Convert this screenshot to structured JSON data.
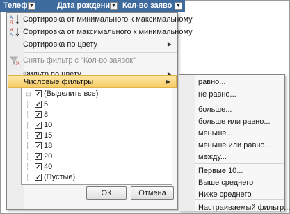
{
  "header": {
    "columns": [
      {
        "label": "Телефо",
        "has_dropdown": true
      },
      {
        "label": "Дата рождени",
        "has_dropdown": true
      },
      {
        "label": "Кол-во заявок",
        "has_dropdown": true,
        "active": true
      }
    ]
  },
  "menu": {
    "sort_asc": "Сортировка от минимального к максимальному",
    "sort_desc": "Сортировка от максимального к минимальному",
    "sort_by_color": "Сортировка по цвету",
    "clear_filter": "Снять фильтр с \"Кол-во заявок\"",
    "filter_by_color": "Фильтр по цвету",
    "number_filters": "Числовые фильтры",
    "icons": {
      "sort_asc": "sort-ascending-icon",
      "sort_desc": "sort-descending-icon",
      "clear": "clear-filter-icon"
    }
  },
  "checklist": {
    "items": [
      {
        "label": "(Выделить все)",
        "checked": true
      },
      {
        "label": "5",
        "checked": true
      },
      {
        "label": "8",
        "checked": true
      },
      {
        "label": "10",
        "checked": true
      },
      {
        "label": "15",
        "checked": true
      },
      {
        "label": "18",
        "checked": true
      },
      {
        "label": "20",
        "checked": true
      },
      {
        "label": "40",
        "checked": true
      },
      {
        "label": "(Пустые)",
        "checked": true
      }
    ],
    "check_mark": "✓"
  },
  "buttons": {
    "ok": "ОК",
    "cancel": "Отмена"
  },
  "submenu": {
    "items": [
      "равно...",
      "не равно...",
      "больше...",
      "больше или равно...",
      "меньше...",
      "меньше или равно...",
      "между...",
      "Первые 10...",
      "Выше среднего",
      "Ниже среднего",
      "Настраиваемый фильтр..."
    ]
  },
  "colors": {
    "header_bg": "#3e6b9e",
    "highlight": "#f8cd6a"
  }
}
